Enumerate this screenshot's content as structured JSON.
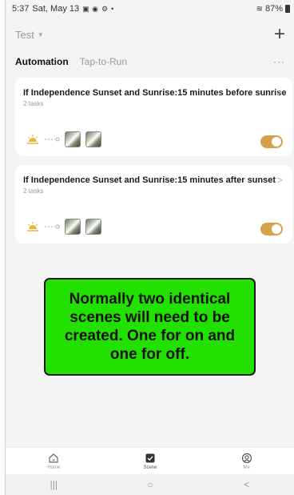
{
  "statusbar": {
    "time": "5:37",
    "date": "Sat, May 13",
    "battery": "87%",
    "icons": [
      "image-icon",
      "messenger-icon",
      "settings-icon",
      "dot-icon"
    ]
  },
  "header": {
    "home_name": "Test",
    "add_label": "+"
  },
  "tabs": [
    {
      "label": "Automation",
      "active": true
    },
    {
      "label": "Tap-to-Run",
      "active": false
    }
  ],
  "more_label": "···",
  "automations": [
    {
      "title": "If Independence Sunset and Sunrise:15 minutes before sunrise",
      "subtitle": "2 tasks",
      "arrow": ">",
      "enabled": true
    },
    {
      "title": "If Independence Sunset and Sunrise:15 minutes after sunset",
      "subtitle": "2 tasks",
      "arrow": ">",
      "enabled": true
    }
  ],
  "callout": {
    "text": "Normally two identical scenes will need to be created. One for on and one for off.",
    "background": "#22e000"
  },
  "bottom_nav": [
    {
      "label": "Home",
      "icon": "home-icon",
      "active": false
    },
    {
      "label": "Scene",
      "icon": "scene-check-icon",
      "active": true
    },
    {
      "label": "Me",
      "icon": "profile-icon",
      "active": false
    }
  ],
  "system_nav": {
    "recents": "|||",
    "home": "○",
    "back": "<"
  },
  "colors": {
    "toggle_on": "#d4a24c",
    "sun": "#e8b63a"
  }
}
